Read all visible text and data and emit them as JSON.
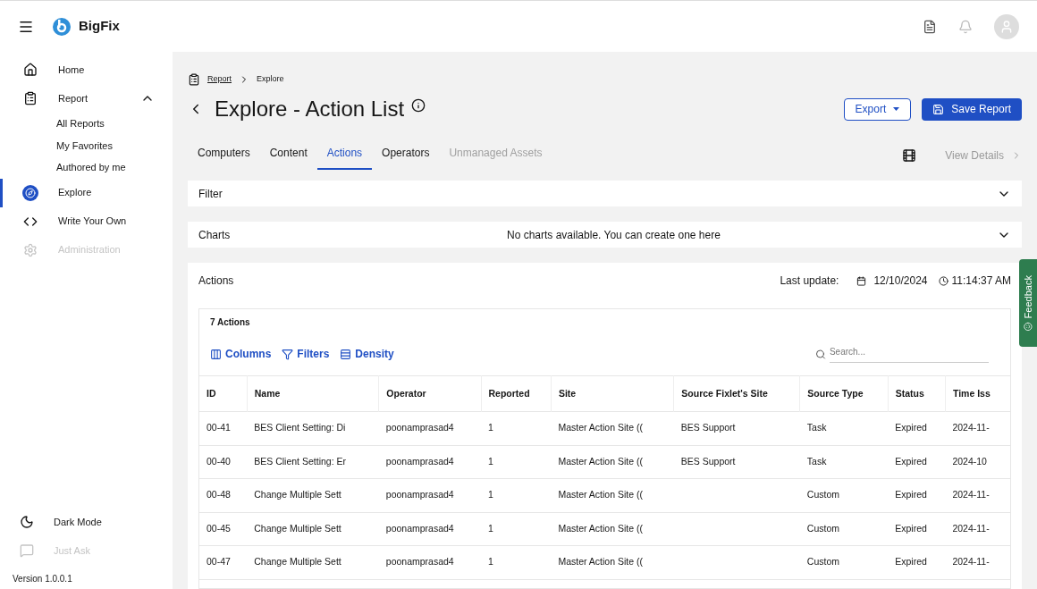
{
  "app": {
    "name": "BigFix",
    "version": "Version 1.0.0.1"
  },
  "sidebar": {
    "items": [
      {
        "kind": "home",
        "label": "Home",
        "selected": false,
        "disabled": false
      },
      {
        "kind": "report",
        "label": "Report",
        "selected": false,
        "disabled": false,
        "expanded": true,
        "children": [
          {
            "label": "All Reports"
          },
          {
            "label": "My Favorites"
          },
          {
            "label": "Authored by me"
          }
        ]
      },
      {
        "kind": "explore",
        "label": "Explore",
        "selected": true,
        "disabled": false
      },
      {
        "kind": "code",
        "label": "Write Your Own",
        "selected": false,
        "disabled": false
      },
      {
        "kind": "gear",
        "label": "Administration",
        "selected": false,
        "disabled": true
      }
    ],
    "bottom": [
      {
        "kind": "moon",
        "label": "Dark Mode",
        "disabled": false
      },
      {
        "kind": "chat",
        "label": "Just Ask",
        "disabled": true
      }
    ]
  },
  "breadcrumb": [
    "Report",
    "Explore"
  ],
  "title": "Explore - Action List",
  "buttons": {
    "export": "Export",
    "save": "Save Report"
  },
  "tabs": [
    {
      "label": "Computers",
      "selected": false,
      "disabled": false
    },
    {
      "label": "Content",
      "selected": false,
      "disabled": false
    },
    {
      "label": "Actions",
      "selected": true,
      "disabled": false
    },
    {
      "label": "Operators",
      "selected": false,
      "disabled": false
    },
    {
      "label": "Unmanaged Assets",
      "selected": false,
      "disabled": true
    }
  ],
  "view_details": {
    "label": "View Details",
    "disabled": true
  },
  "filter": {
    "label": "Filter",
    "expanded": false
  },
  "charts": {
    "label": "Charts",
    "message": "No charts available. You can create one here",
    "expanded": false
  },
  "actions_panel": {
    "title": "Actions",
    "last_update_label": "Last update:",
    "date": "12/10/2024",
    "time": "11:14:37 AM"
  },
  "grid": {
    "count": "7 Actions",
    "toolbar": [
      "Columns",
      "Filters",
      "Density"
    ],
    "search": {
      "placeholder": "Search..."
    },
    "columns": [
      "ID",
      "Name",
      "Operator",
      "Reported",
      "Site",
      "Source Fixlet's Site",
      "Source Type",
      "Status",
      "Time Iss"
    ],
    "rows": [
      [
        "00-41",
        "BES Client Setting: Di",
        "poonamprasad4",
        "1",
        "Master Action Site ((",
        "BES Support",
        "Task",
        "Expired",
        "2024-11-"
      ],
      [
        "00-40",
        "BES Client Setting: Er",
        "poonamprasad4",
        "1",
        "Master Action Site ((",
        "BES Support",
        "Task",
        "Expired",
        "2024-10"
      ],
      [
        "00-48",
        "Change Multiple Sett",
        "poonamprasad4",
        "1",
        "Master Action Site ((",
        "",
        "Custom",
        "Expired",
        "2024-11-"
      ],
      [
        "00-45",
        "Change Multiple Sett",
        "poonamprasad4",
        "1",
        "Master Action Site ((",
        "",
        "Custom",
        "Expired",
        "2024-11-"
      ],
      [
        "00-47",
        "Change Multiple Sett",
        "poonamprasad4",
        "1",
        "Master Action Site ((",
        "",
        "Custom",
        "Expired",
        "2024-11-"
      ]
    ]
  },
  "feedback": "Feedback"
}
